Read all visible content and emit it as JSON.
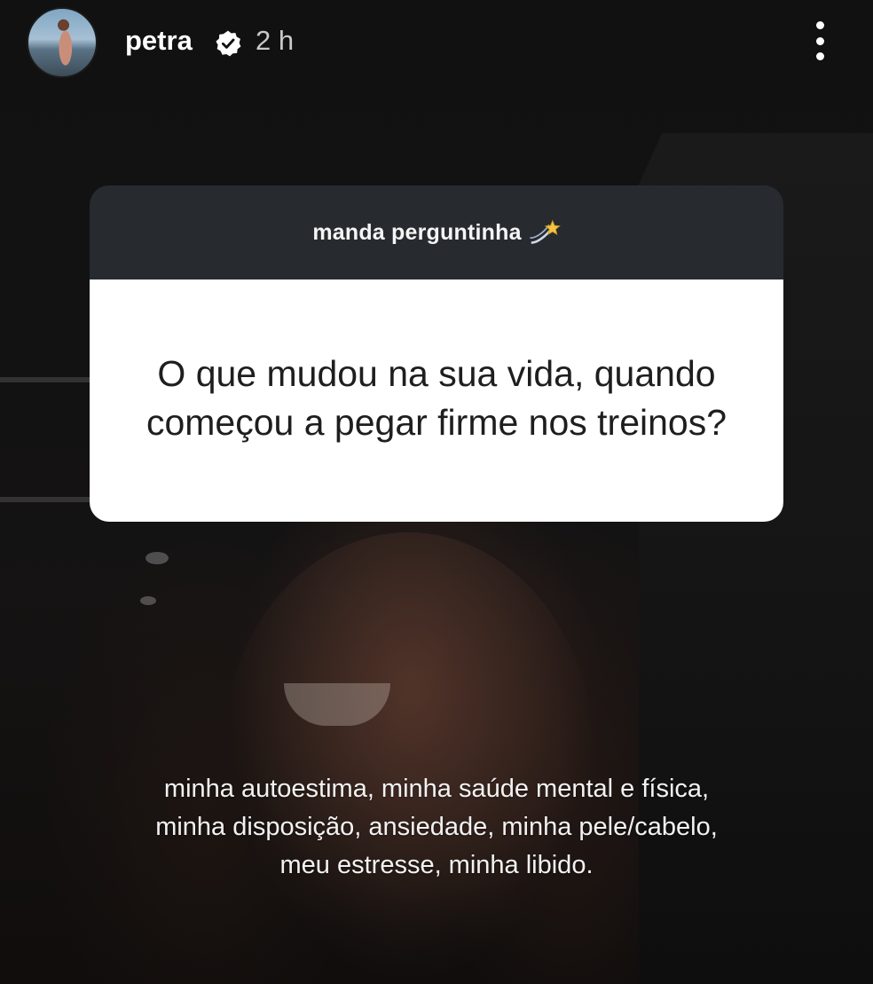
{
  "header": {
    "username": "petra",
    "time": "2 h",
    "avatar_icon": "avatar",
    "verified_icon": "verified-badge-icon",
    "more_icon": "more-options-icon"
  },
  "question_sticker": {
    "prompt": "manda perguntinha",
    "prompt_icon": "dizzy-icon",
    "question": "O que mudou na sua vida, quando começou a pegar firme nos treinos?"
  },
  "answer": {
    "text": "minha autoestima, minha saúde mental e física, minha disposição, ansiedade, minha pele/cabelo, meu estresse, minha libido."
  },
  "colors": {
    "sticker_header": "#272a2f",
    "sticker_body": "#ffffff",
    "question_text": "#1e1e1e",
    "time_text": "#c9c9c9"
  }
}
